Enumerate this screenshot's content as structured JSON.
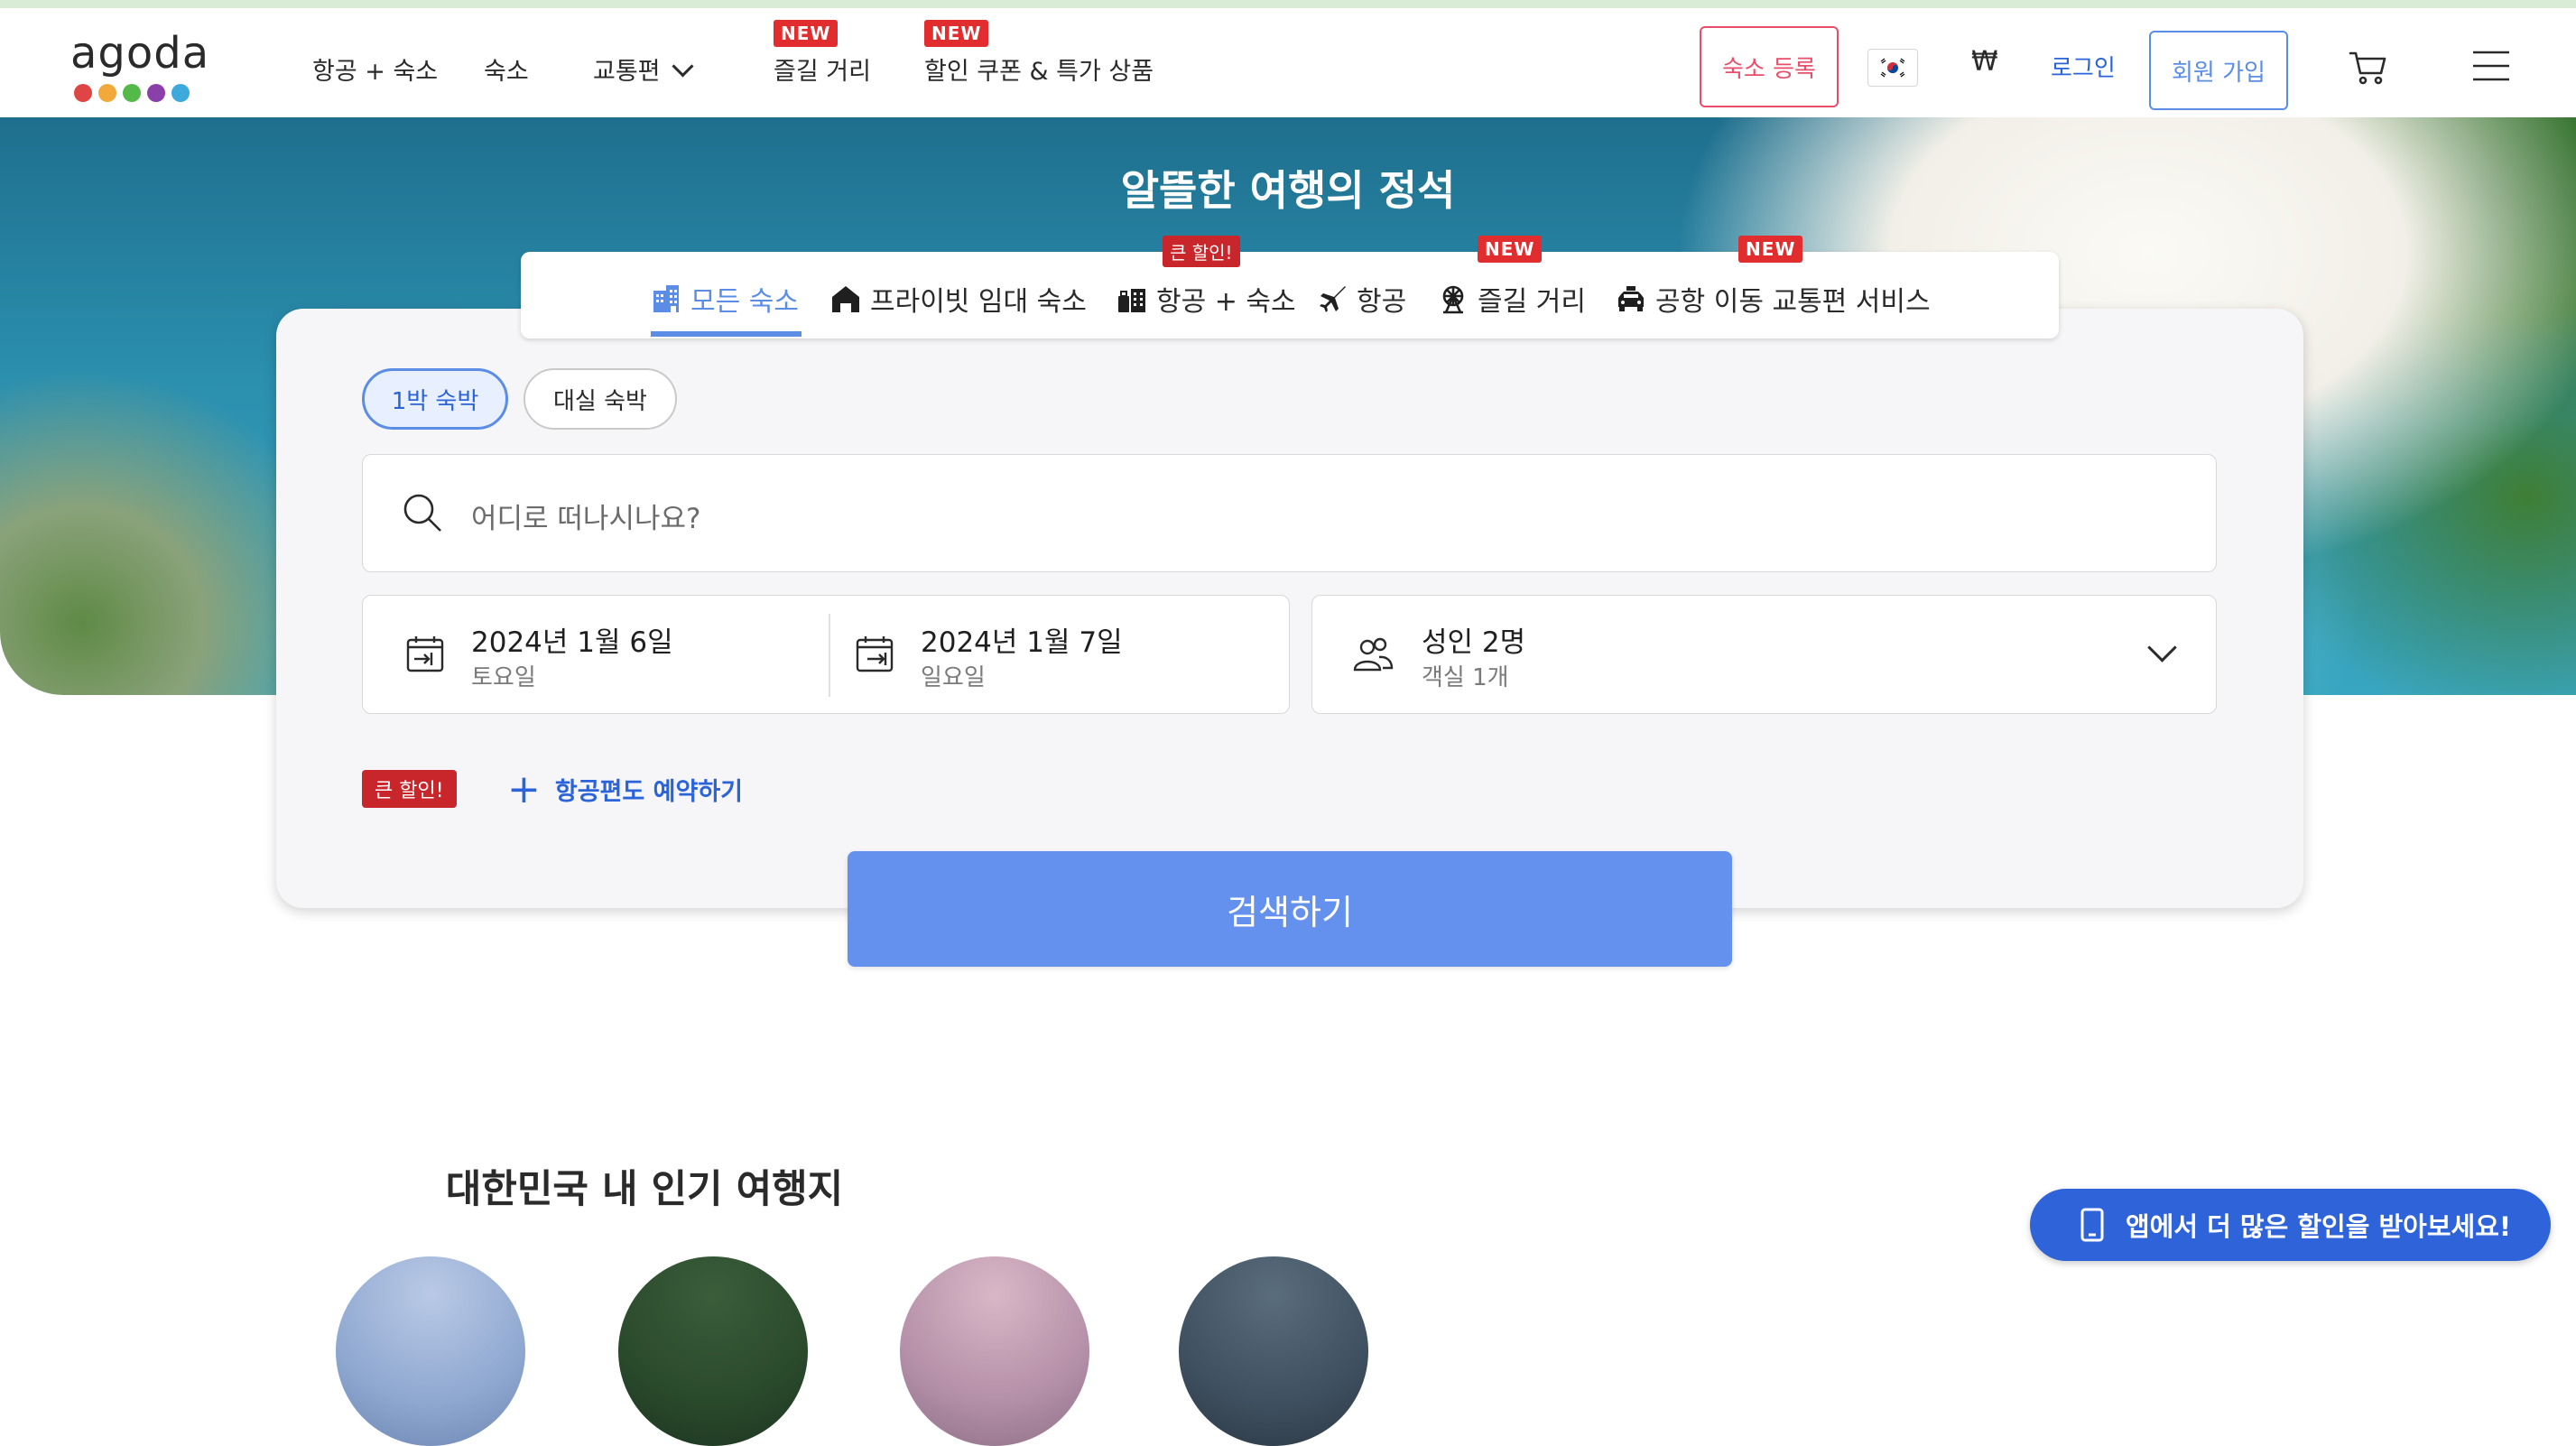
{
  "header": {
    "logo_text": "agoda",
    "logo_dot_colors": [
      "#e04545",
      "#f2a93b",
      "#54b948",
      "#8b3fa8",
      "#3da9dc"
    ],
    "nav": [
      {
        "label": "항공 + 숙소"
      },
      {
        "label": "숙소"
      },
      {
        "label": "교통편",
        "dropdown": true
      },
      {
        "label": "즐길 거리",
        "badge": "NEW"
      },
      {
        "label": "할인 쿠폰 & 특가 상품",
        "badge": "NEW"
      }
    ],
    "register_label": "숙소 등록",
    "flag_icon": "korea-flag-icon",
    "currency": "₩",
    "login_label": "로그인",
    "signup_label": "회원 가입",
    "cart_icon": "cart-icon",
    "menu_icon": "menu-icon"
  },
  "hero": {
    "title": "알뜰한 여행의 정석"
  },
  "tabs": [
    {
      "label": "모든 숙소",
      "icon": "building-icon",
      "active": true
    },
    {
      "label": "프라이빗 임대 숙소",
      "icon": "house-icon"
    },
    {
      "label": "항공 + 숙소",
      "icon": "luggage-hotel-icon",
      "badge": "큰 할인!"
    },
    {
      "label": "항공",
      "icon": "plane-icon"
    },
    {
      "label": "즐길 거리",
      "icon": "ferris-wheel-icon",
      "badge": "NEW"
    },
    {
      "label": "공항 이동 교통편 서비스",
      "icon": "car-icon",
      "badge": "NEW"
    }
  ],
  "search": {
    "stay_types": [
      "1박 숙박",
      "대실 숙박"
    ],
    "destination_placeholder": "어디로 떠나시나요?",
    "checkin": {
      "date": "2024년 1월 6일",
      "weekday": "토요일"
    },
    "checkout": {
      "date": "2024년 1월 7일",
      "weekday": "일요일"
    },
    "guests": {
      "main": "성인 2명",
      "sub": "객실 1개"
    },
    "deal_badge": "큰 할인!",
    "add_flight_label": "항공편도 예약하기",
    "button_label": "검색하기"
  },
  "colors": {
    "accent": "#5b8de6",
    "link": "#2b63d9",
    "register": "#e84d6a",
    "badge_red": "#e12d2d",
    "search_button": "#6490ee",
    "app_banner": "#2f63d9"
  },
  "popular": {
    "title": "대한민국 내 인기 여행지"
  },
  "app_banner": {
    "label": "앱에서 더 많은 할인을 받아보세요!",
    "icon": "phone-icon"
  }
}
